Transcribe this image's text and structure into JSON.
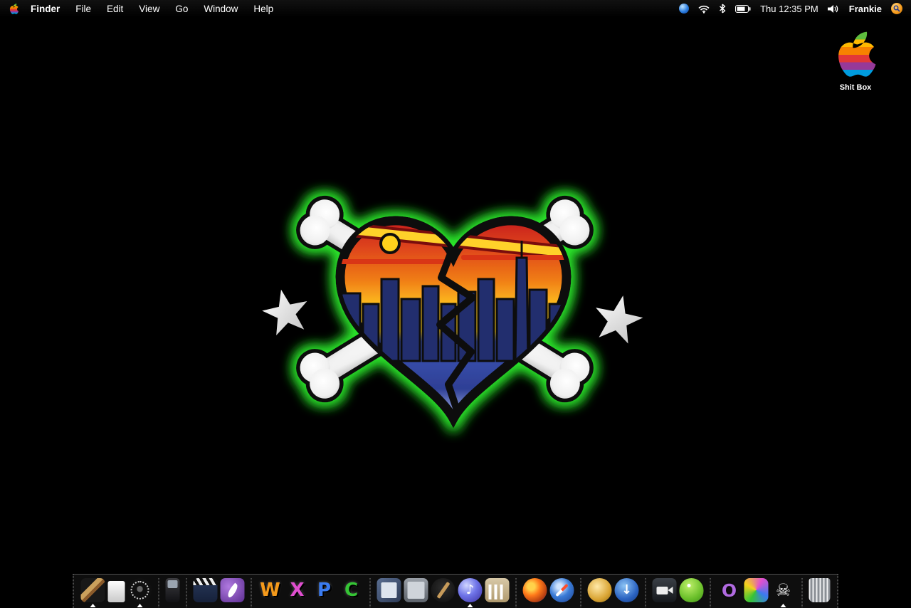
{
  "menu_bar": {
    "items": [
      "Finder",
      "File",
      "Edit",
      "View",
      "Go",
      "Window",
      "Help"
    ],
    "status": {
      "clock": "Thu 12:35 PM",
      "user": "Frankie"
    },
    "status_icons": [
      "status-orb",
      "wifi",
      "bluetooth",
      "battery",
      "volume",
      "spotlight"
    ]
  },
  "desktop": {
    "drive_label": "Shit Box"
  },
  "dock": {
    "items": [
      {
        "name": "finder",
        "running": true
      },
      {
        "name": "notes"
      },
      {
        "name": "dvd-player",
        "running": true
      },
      {
        "type": "separator"
      },
      {
        "name": "ipod"
      },
      {
        "type": "separator"
      },
      {
        "name": "imovie"
      },
      {
        "name": "quill-pen"
      },
      {
        "type": "separator"
      },
      {
        "name": "app-w",
        "glyph": "W"
      },
      {
        "name": "app-x",
        "glyph": "X"
      },
      {
        "name": "app-p",
        "glyph": "P"
      },
      {
        "name": "app-c",
        "glyph": "C"
      },
      {
        "type": "separator"
      },
      {
        "name": "photo-album"
      },
      {
        "name": "image-viewer"
      },
      {
        "name": "garageband"
      },
      {
        "name": "itunes",
        "glyph": "♪",
        "running": true
      },
      {
        "name": "bank-building"
      },
      {
        "type": "separator"
      },
      {
        "name": "firefox"
      },
      {
        "name": "compass-browser"
      },
      {
        "type": "separator"
      },
      {
        "name": "gold-coin"
      },
      {
        "name": "download-arrow",
        "glyph": "↓"
      },
      {
        "type": "separator"
      },
      {
        "name": "video-camera"
      },
      {
        "name": "adium-duck"
      },
      {
        "type": "separator"
      },
      {
        "name": "ring-o",
        "glyph": "O"
      },
      {
        "name": "toy-robot"
      },
      {
        "name": "skull",
        "glyph": "☠",
        "running": true
      },
      {
        "type": "separator"
      },
      {
        "name": "trash"
      }
    ]
  },
  "colors": {
    "glow_green": "#2ce62c",
    "spotlight_orange": "#f59a1b",
    "menu_bar_bg": "#000000"
  }
}
